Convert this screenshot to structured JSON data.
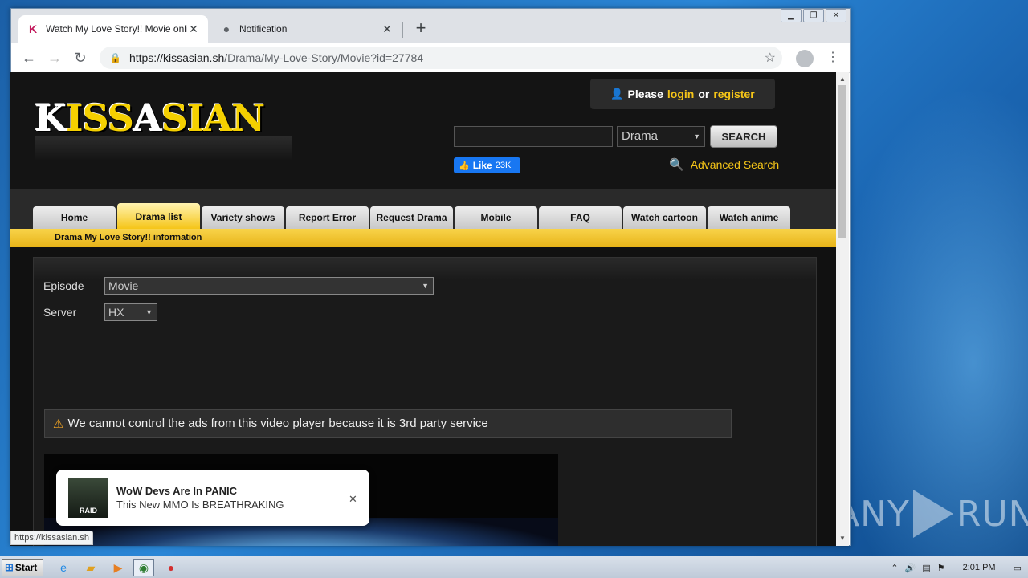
{
  "browser": {
    "tabs": [
      {
        "title": "Watch My Love Story!! Movie online",
        "favicon": "K",
        "active": true
      },
      {
        "title": "Notification",
        "favicon": "globe-icon",
        "active": false
      }
    ],
    "new_tab": "+",
    "url_host": "https://kissasian.sh",
    "url_path": "/Drama/My-Love-Story/Movie?id=27784",
    "status_url": "https://kissasian.sh"
  },
  "site": {
    "logo_k": "K",
    "logo_rest": "ISS",
    "logo_a": "A",
    "logo_end": "SIAN",
    "login": {
      "please": "Please",
      "login": "login",
      "or": "or",
      "register": "register"
    },
    "search": {
      "category": "Drama",
      "button": "SEARCH"
    },
    "fb": {
      "like": "Like",
      "count": "23K"
    },
    "advanced_search": "Advanced Search",
    "nav": [
      "Home",
      "Drama list",
      "Variety shows",
      "Report Error",
      "Request Drama",
      "Mobile",
      "FAQ",
      "Watch cartoon",
      "Watch anime"
    ],
    "nav_active": "Drama list",
    "info_bar": "Drama My Love Story!! information",
    "episode_label": "Episode",
    "episode_value": "Movie",
    "server_label": "Server",
    "server_value": "HX",
    "warning": "We cannot control the ads from this video player because it is 3rd party service"
  },
  "notification": {
    "title": "WoW Devs Are In PANIC",
    "body": "This New MMO Is BREATHRAKING",
    "thumb_text": "RAID"
  },
  "taskbar": {
    "start": "Start",
    "clock": "2:01 PM"
  },
  "watermark": {
    "left": "ANY",
    "right": "RUN"
  },
  "colors": {
    "accent_yellow": "#f5c518",
    "fb_blue": "#1877f2"
  }
}
